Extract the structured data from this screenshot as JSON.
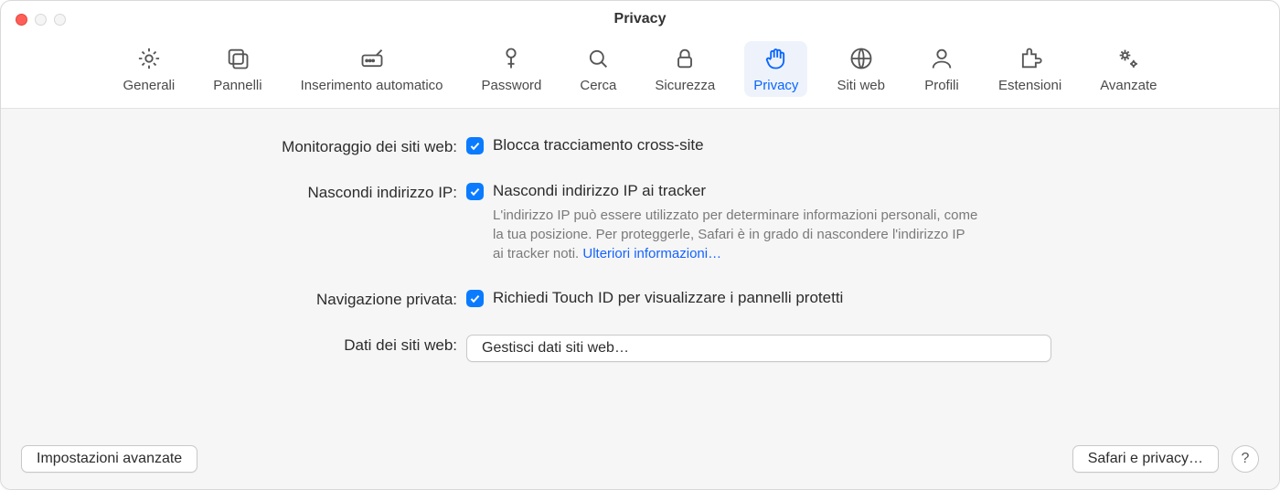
{
  "window": {
    "title": "Privacy"
  },
  "tabs": [
    {
      "id": "general",
      "label": "Generali"
    },
    {
      "id": "panels",
      "label": "Pannelli"
    },
    {
      "id": "autofill",
      "label": "Inserimento automatico"
    },
    {
      "id": "passwords",
      "label": "Password"
    },
    {
      "id": "search",
      "label": "Cerca"
    },
    {
      "id": "security",
      "label": "Sicurezza"
    },
    {
      "id": "privacy",
      "label": "Privacy",
      "active": true
    },
    {
      "id": "websites",
      "label": "Siti web"
    },
    {
      "id": "profiles",
      "label": "Profili"
    },
    {
      "id": "extensions",
      "label": "Estensioni"
    },
    {
      "id": "advanced",
      "label": "Avanzate"
    }
  ],
  "section": {
    "tracking_label": "Monitoraggio dei siti web:",
    "tracking_checkbox": "Blocca tracciamento cross-site",
    "hide_ip_label": "Nascondi indirizzo IP:",
    "hide_ip_checkbox": "Nascondi indirizzo IP ai tracker",
    "hide_ip_hint": "L'indirizzo IP può essere utilizzato per determinare informazioni personali, come la tua posizione. Per proteggerle, Safari è in grado di nascondere l'indirizzo IP ai tracker noti. ",
    "hide_ip_more": "Ulteriori informazioni…",
    "private_label": "Navigazione privata:",
    "private_checkbox": "Richiedi Touch ID per visualizzare i pannelli protetti",
    "website_data_label": "Dati dei siti web:",
    "manage_button": "Gestisci dati siti web…"
  },
  "footer": {
    "advanced_settings": "Impostazioni avanzate",
    "safari_privacy": "Safari e privacy…",
    "help": "?"
  },
  "checked": {
    "tracking": true,
    "hide_ip": true,
    "private": true
  }
}
